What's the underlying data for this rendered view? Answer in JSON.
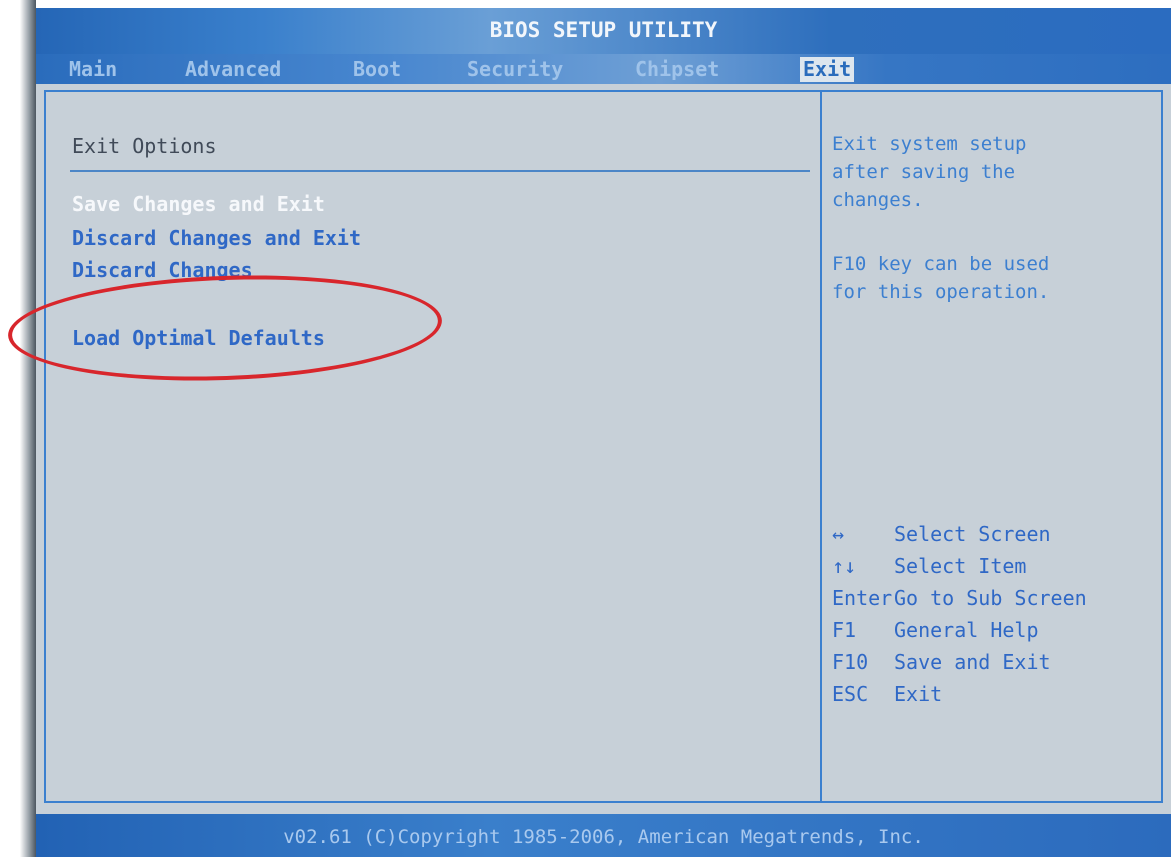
{
  "window": {
    "title": "BIOS SETUP UTILITY"
  },
  "tabs": [
    {
      "label": "Main",
      "active": false
    },
    {
      "label": "Advanced",
      "active": false
    },
    {
      "label": "Boot",
      "active": false
    },
    {
      "label": "Security",
      "active": false
    },
    {
      "label": "Chipset",
      "active": false
    },
    {
      "label": "Exit",
      "active": true
    }
  ],
  "main": {
    "section_title": "Exit Options",
    "items": [
      {
        "label": "Save Changes and Exit",
        "selected": true
      },
      {
        "label": "Discard Changes and Exit",
        "selected": false
      },
      {
        "label": "Discard Changes",
        "selected": false
      },
      {
        "label": "Load Optimal Defaults",
        "selected": false
      }
    ]
  },
  "help": {
    "description_lines": [
      "Exit system setup",
      "after saving the",
      "changes.",
      "",
      "F10 key can be used",
      "for this operation."
    ],
    "keys": [
      {
        "key": "↔",
        "action": "Select Screen"
      },
      {
        "key": "↑↓",
        "action": "Select Item"
      },
      {
        "key": "Enter",
        "action": "Go to Sub Screen"
      },
      {
        "key": "F1",
        "action": "General Help"
      },
      {
        "key": "F10",
        "action": "Save and Exit"
      },
      {
        "key": "ESC",
        "action": "Exit"
      }
    ]
  },
  "footer": {
    "text": "v02.61 (C)Copyright 1985-2006, American Megatrends, Inc."
  },
  "colors": {
    "background": "#c7d0d8",
    "accent_blue": "#2f68c6",
    "selected_text": "#f6f8fb",
    "annotation_red": "#d8262c"
  }
}
